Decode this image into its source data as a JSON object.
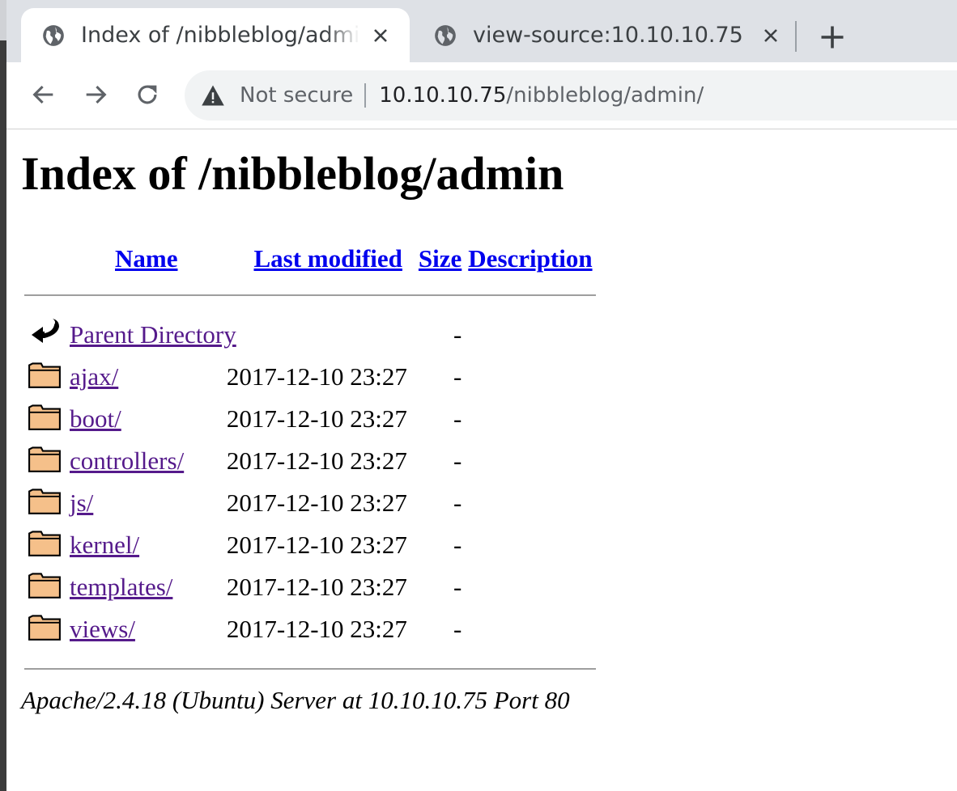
{
  "browser": {
    "tabs": [
      {
        "title": "Index of /nibbleblog/admin/",
        "active": true
      },
      {
        "title": "view-source:10.10.10.75",
        "active": false
      }
    ],
    "omnibox": {
      "security_label": "Not secure",
      "url_host": "10.10.10.75",
      "url_path": "/nibbleblog/admin/"
    }
  },
  "page": {
    "heading": "Index of /nibbleblog/admin",
    "columns": {
      "name": "Name",
      "last_modified": "Last modified",
      "size": "Size",
      "description": "Description"
    },
    "parent": {
      "label": "Parent Directory",
      "size": "-"
    },
    "entries": [
      {
        "name": "ajax/",
        "modified": "2017-12-10 23:27",
        "size": "-"
      },
      {
        "name": "boot/",
        "modified": "2017-12-10 23:27",
        "size": "-"
      },
      {
        "name": "controllers/",
        "modified": "2017-12-10 23:27",
        "size": "-"
      },
      {
        "name": "js/",
        "modified": "2017-12-10 23:27",
        "size": "-"
      },
      {
        "name": "kernel/",
        "modified": "2017-12-10 23:27",
        "size": "-"
      },
      {
        "name": "templates/",
        "modified": "2017-12-10 23:27",
        "size": "-"
      },
      {
        "name": "views/",
        "modified": "2017-12-10 23:27",
        "size": "-"
      }
    ],
    "address": "Apache/2.4.18 (Ubuntu) Server at 10.10.10.75 Port 80"
  },
  "colors": {
    "link": "#0000ee",
    "visited_link": "#551a8b",
    "tabbar": "#dee1e6",
    "omnibox": "#f1f3f4"
  }
}
